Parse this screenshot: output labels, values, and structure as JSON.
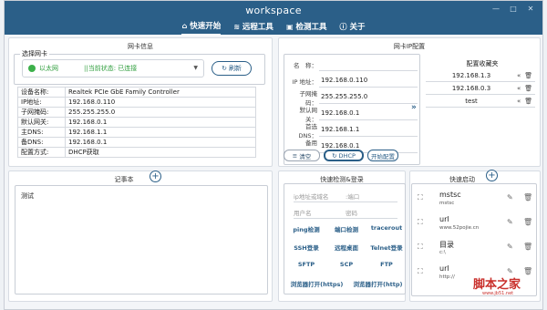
{
  "app": {
    "title": "workspace"
  },
  "window_buttons": [
    "—",
    "□",
    "✕"
  ],
  "tabs": [
    {
      "label": "快速开始",
      "icon": "home-icon",
      "active": true
    },
    {
      "label": "远程工具",
      "icon": "wifi-icon",
      "active": false
    },
    {
      "label": "检测工具",
      "icon": "monitor-icon",
      "active": false
    },
    {
      "label": "关于",
      "icon": "info-icon",
      "active": false
    }
  ],
  "nic": {
    "title": "网卡信息",
    "select_legend": "选择网卡",
    "selected": "以太网",
    "status": "||当前状态: 已连接",
    "refresh_label": "刷新",
    "rows": [
      {
        "k": "设备名称:",
        "v": "Realtek PCIe GbE Family Controller"
      },
      {
        "k": "IP地址:",
        "v": "192.168.0.110"
      },
      {
        "k": "子网掩码:",
        "v": "255.255.255.0"
      },
      {
        "k": "默认网关:",
        "v": "192.168.0.1"
      },
      {
        "k": "主DNS:",
        "v": "192.168.1.1"
      },
      {
        "k": "备DNS:",
        "v": "192.168.0.1"
      },
      {
        "k": "配置方式:",
        "v": "DHCP获取"
      }
    ]
  },
  "ipconfig": {
    "title": "网卡IP配置",
    "name_label": "名　称：",
    "fields": [
      {
        "label": "IP 地址：",
        "value": "192.168.0.110"
      },
      {
        "label": "子网掩码：",
        "value": "255.255.255.0"
      },
      {
        "label": "默认网关：",
        "value": "192.168.0.1"
      },
      {
        "label": "首选DNS：",
        "value": "192.168.1.1"
      },
      {
        "label": "备用DNS：",
        "value": "192.168.0.1"
      }
    ],
    "btn_clear": "清空",
    "btn_dhcp": "DHCP",
    "btn_apply": "开始配置",
    "fav_title": "配置收藏夹",
    "favorites": [
      "192.168.1.3",
      "192.168.0.3",
      "test"
    ]
  },
  "memo": {
    "title": "记事本",
    "content": "测试"
  },
  "quick": {
    "title": "快速检测&登录",
    "ip_placeholder": "ip地址或域名",
    "port_placeholder": ":端口",
    "user_placeholder": "用户名",
    "pass_placeholder": "密码",
    "links": [
      [
        "ping检测",
        "端口检测",
        "tracerout"
      ],
      [
        "SSH登录",
        "远程桌面",
        "Telnet登录"
      ],
      [
        "SFTP",
        "SCP",
        "FTP"
      ],
      [
        "浏览器打开(https)",
        "浏览器打开(http)"
      ]
    ]
  },
  "launch": {
    "title": "快速启动",
    "items": [
      {
        "name": "mstsc",
        "sub": "mstsc"
      },
      {
        "name": "url",
        "sub": "www.52pojie.cn"
      },
      {
        "name": "目录",
        "sub": "c:\\"
      },
      {
        "name": "url",
        "sub": "http://"
      }
    ]
  },
  "watermark": {
    "main": "脚本之家",
    "sub": "www.jb51.net"
  },
  "colors": {
    "header": "#2b5f88",
    "status_green": "#2f9e3d",
    "accent": "#2b5f88"
  }
}
